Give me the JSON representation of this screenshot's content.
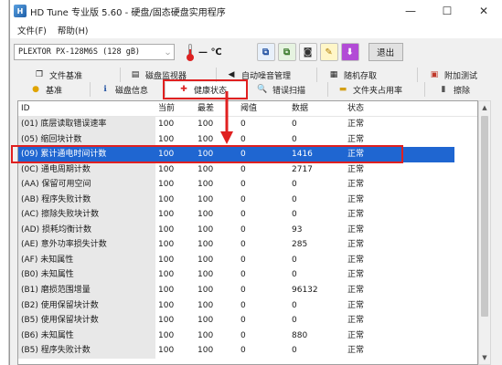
{
  "window": {
    "title": "HD Tune 专业版 5.60 - 硬盘/固态硬盘实用程序",
    "minimize": "—",
    "maximize": "☐",
    "close": "✕"
  },
  "menu": [
    "文件(F)",
    "帮助(H)"
  ],
  "toolbar": {
    "drive": "PLEXTOR PX-128M6S (128 gB)",
    "temperature": "— ℃",
    "exit_label": "退出"
  },
  "tabs_row1": [
    {
      "label": "文件基准",
      "icon": "file-benchmark-icon"
    },
    {
      "label": "磁盘监视器",
      "icon": "disk-monitor-icon"
    },
    {
      "label": "自动噪音管理",
      "icon": "noise-management-icon"
    },
    {
      "label": "随机存取",
      "icon": "random-access-icon"
    },
    {
      "label": "附加测试",
      "icon": "extra-tests-icon"
    }
  ],
  "tabs_row2": [
    {
      "label": "基准",
      "icon": "benchmark-icon"
    },
    {
      "label": "磁盘信息",
      "icon": "disk-info-icon"
    },
    {
      "label": "健康状态",
      "icon": "health-icon",
      "active": true
    },
    {
      "label": "错误扫描",
      "icon": "error-scan-icon"
    },
    {
      "label": "文件夹占用率",
      "icon": "folder-usage-icon"
    },
    {
      "label": "擦除",
      "icon": "erase-icon"
    }
  ],
  "table": {
    "headers": [
      "ID",
      "当前",
      "最差",
      "阈值",
      "数据",
      "状态"
    ],
    "rows": [
      [
        "(01) 底层读取错误速率",
        "100",
        "100",
        "0",
        "0",
        "正常"
      ],
      [
        "(05) 缩回块计数",
        "100",
        "100",
        "0",
        "0",
        "正常"
      ],
      [
        "(09) 累计通电时间计数",
        "100",
        "100",
        "0",
        "1416",
        "正常"
      ],
      [
        "(0C) 通电周期计数",
        "100",
        "100",
        "0",
        "2717",
        "正常"
      ],
      [
        "(AA) 保留可用空间",
        "100",
        "100",
        "0",
        "0",
        "正常"
      ],
      [
        "(AB) 程序失败计数",
        "100",
        "100",
        "0",
        "0",
        "正常"
      ],
      [
        "(AC) 擦除失败块计数",
        "100",
        "100",
        "0",
        "0",
        "正常"
      ],
      [
        "(AD) 损耗均衡计数",
        "100",
        "100",
        "0",
        "93",
        "正常"
      ],
      [
        "(AE) 意外功率损失计数",
        "100",
        "100",
        "0",
        "285",
        "正常"
      ],
      [
        "(AF) 未知属性",
        "100",
        "100",
        "0",
        "0",
        "正常"
      ],
      [
        "(B0) 未知属性",
        "100",
        "100",
        "0",
        "0",
        "正常"
      ],
      [
        "(B1) 磨损范围增量",
        "100",
        "100",
        "0",
        "96132",
        "正常"
      ],
      [
        "(B2) 使用保留块计数",
        "100",
        "100",
        "0",
        "0",
        "正常"
      ],
      [
        "(B5) 使用保留块计数",
        "100",
        "100",
        "0",
        "0",
        "正常"
      ],
      [
        "(B6) 未知属性",
        "100",
        "100",
        "0",
        "880",
        "正常"
      ],
      [
        "(B5) 程序失败计数",
        "100",
        "100",
        "0",
        "0",
        "正常"
      ]
    ],
    "selected_index": 2
  },
  "colors": {
    "selection": "#1f66d1",
    "highlight_box": "#e02020",
    "id_column_bg": "#e8e8e8"
  }
}
